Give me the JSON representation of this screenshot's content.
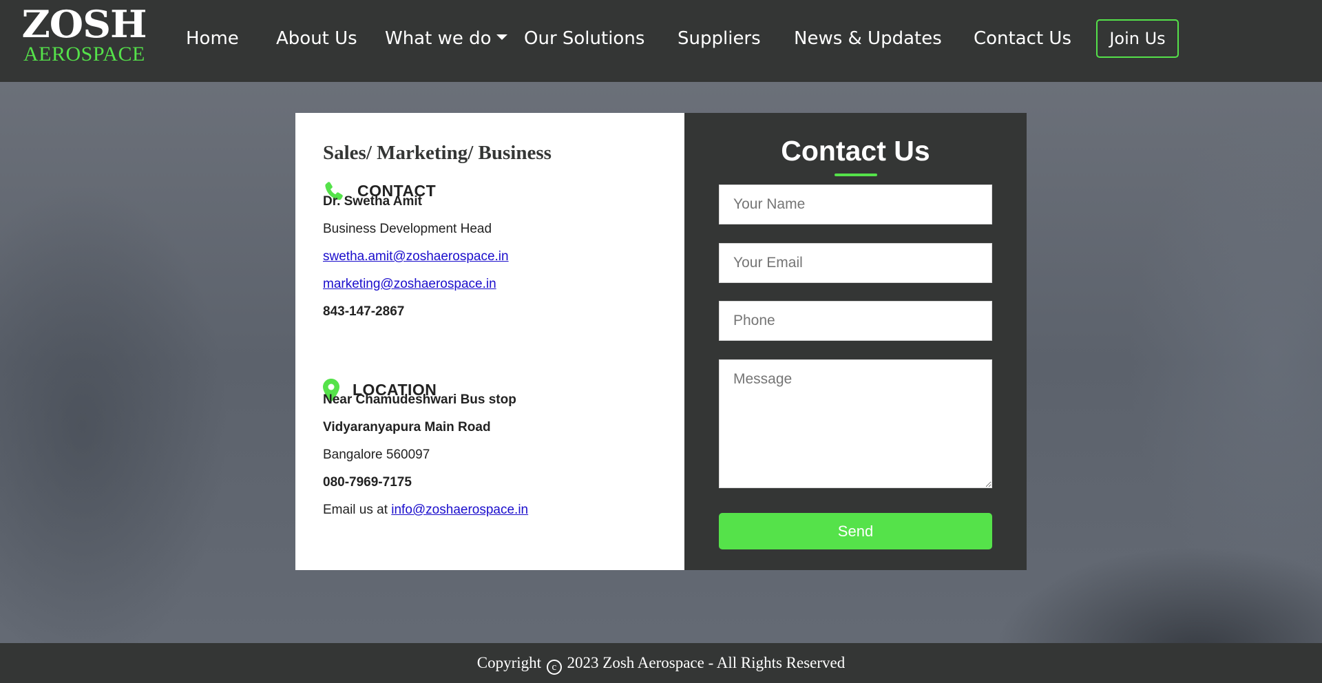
{
  "brand": {
    "name_top": "ZOSH",
    "name_bottom": "AEROSPACE",
    "accent_color": "#55e24a",
    "dark_color": "#343635"
  },
  "nav": {
    "items": [
      {
        "label": "Home"
      },
      {
        "label": "About Us"
      },
      {
        "label": "What we do",
        "has_dropdown": true
      },
      {
        "label": "Our Solutions"
      },
      {
        "label": "Suppliers"
      },
      {
        "label": "News & Updates"
      },
      {
        "label": "Contact Us"
      }
    ],
    "join_label": "Join Us"
  },
  "info": {
    "heading": "Sales/ Marketing/ Business",
    "contact": {
      "icon": "phone-icon",
      "label": "CONTACT",
      "name": "Dr. Swetha Amit",
      "role": "Business Development Head",
      "email1": "swetha.amit@zoshaerospace.in",
      "email2": "marketing@zoshaerospace.in",
      "phone": "843-147-2867"
    },
    "location": {
      "icon": "map-pin-icon",
      "label": "LOCATION",
      "line1": "Near Chamudeshwari Bus stop",
      "line2": "Vidyaranyapura Main Road",
      "line3": "Bangalore 560097",
      "phone": "080-7969-7175",
      "email_prefix": "Email us at",
      "email": "info@zoshaerospace.in"
    }
  },
  "form": {
    "title": "Contact Us",
    "name_placeholder": "Your Name",
    "email_placeholder": "Your Email",
    "phone_placeholder": "Phone",
    "message_placeholder": "Message",
    "send_label": "Send"
  },
  "footer": {
    "copyright_word": "Copyright",
    "copyright_symbol": "c",
    "text": "2023 Zosh Aerospace - All Rights Reserved"
  }
}
